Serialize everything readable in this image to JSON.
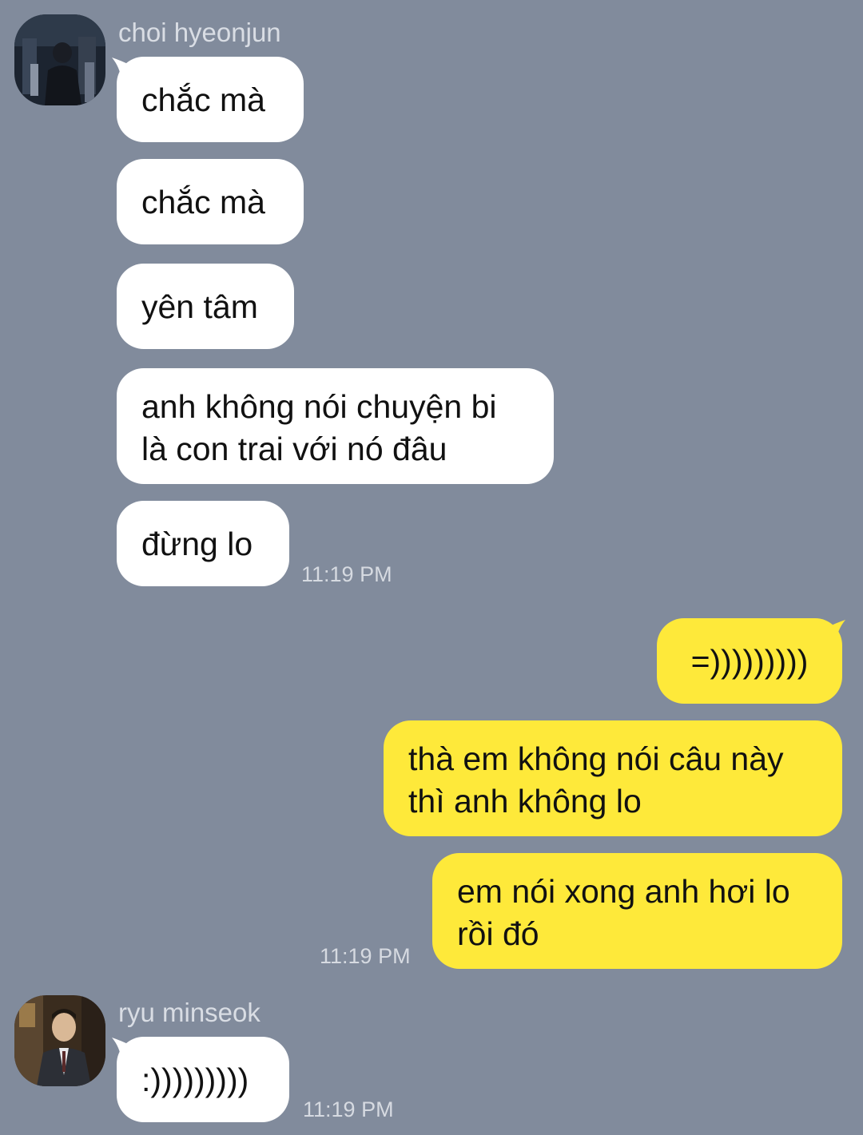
{
  "colors": {
    "background": "#818b9c",
    "incoming_bubble": "#ffffff",
    "outgoing_bubble": "#fee93a",
    "meta_text": "#d6dae1"
  },
  "conversation": {
    "group1": {
      "sender": "choi hyeonjun",
      "avatar_icon": "profile-photo",
      "messages": [
        "chắc mà",
        "chắc mà",
        "yên tâm",
        "anh không nói chuyện bi\nlà con trai với nó đâu",
        "đừng lo"
      ],
      "time": "11:19 PM"
    },
    "group2": {
      "messages": [
        "=)))))))))",
        "thà em không nói câu này\nthì anh không lo",
        "em nói xong anh hơi lo\nrồi đó"
      ],
      "time": "11:19 PM"
    },
    "group3": {
      "sender": "ryu minseok",
      "avatar_icon": "profile-photo",
      "messages": [
        ":)))))))))"
      ],
      "time": "11:19 PM"
    }
  }
}
